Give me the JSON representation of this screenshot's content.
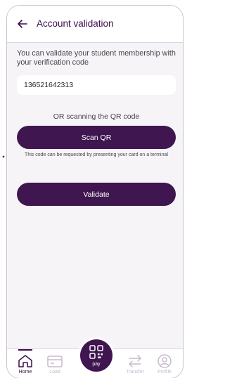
{
  "header": {
    "title": "Account validation",
    "back_icon": "arrow-left-icon"
  },
  "form": {
    "description": "You can validate your student membership with your verification code",
    "code_value": "136521642313",
    "or_text": "OR scanning the QR code",
    "scan_button_label": "Scan QR",
    "hint": "This code can be requested by presenting your card on a terminal",
    "validate_button_label": "Validate"
  },
  "bottom_nav": {
    "items": [
      {
        "label": "Home",
        "icon": "home-icon",
        "active": true
      },
      {
        "label": "Load",
        "icon": "card-icon",
        "active": false
      },
      {
        "label": "pay",
        "icon": "qr-code-icon",
        "active": false
      },
      {
        "label": "Transfer",
        "icon": "transfer-icon",
        "active": false
      },
      {
        "label": "Profile",
        "icon": "profile-icon",
        "active": false
      }
    ]
  },
  "colors": {
    "primary": "#3f1650",
    "background": "#f6f4f7",
    "muted": "#c9b9cf",
    "dots_accent": "#5a2a7a"
  }
}
